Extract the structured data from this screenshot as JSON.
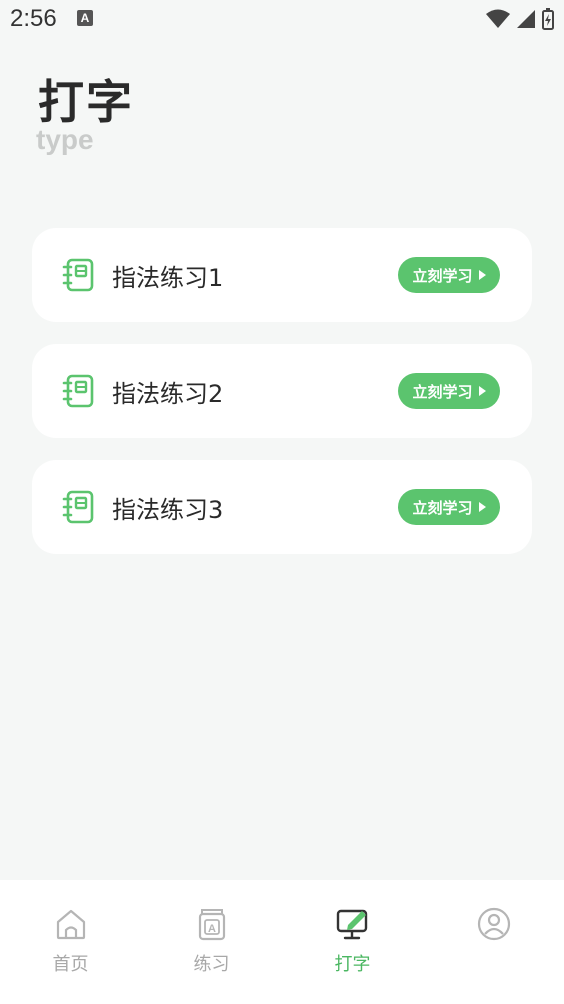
{
  "status_bar": {
    "time": "2:56",
    "notification_icon": "A"
  },
  "header": {
    "title": "打字",
    "subtitle": "type"
  },
  "cards": [
    {
      "label": "指法练习1",
      "button_label": "立刻学习",
      "icon": "notebook-icon"
    },
    {
      "label": "指法练习2",
      "button_label": "立刻学习",
      "icon": "notebook-icon"
    },
    {
      "label": "指法练习3",
      "button_label": "立刻学习",
      "icon": "notebook-icon"
    }
  ],
  "bottom_nav": {
    "items": [
      {
        "label": "首页",
        "icon": "home-icon",
        "active": false
      },
      {
        "label": "练习",
        "icon": "book-icon",
        "active": false
      },
      {
        "label": "打字",
        "icon": "monitor-pen-icon",
        "active": true
      },
      {
        "label": "",
        "icon": "profile-icon",
        "active": false
      }
    ]
  },
  "colors": {
    "accent": "#5bc46e",
    "background": "#f5f7f6",
    "inactive": "#a8a8a8"
  }
}
